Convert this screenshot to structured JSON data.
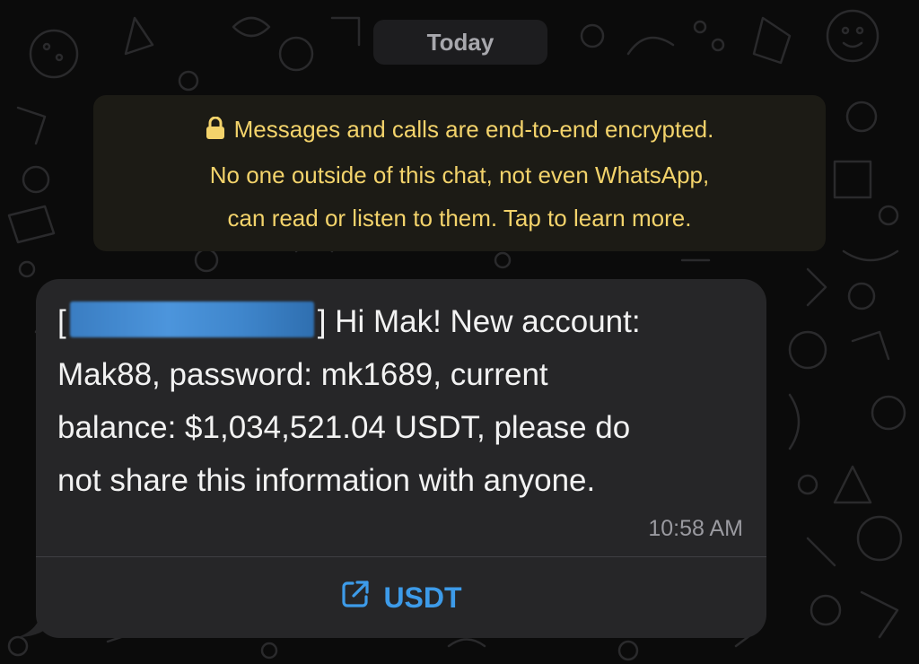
{
  "chat": {
    "date_label": "Today",
    "encryption_notice": {
      "icon": "lock-icon",
      "line1": "Messages and calls are end-to-end encrypted.",
      "line2": "No one outside of this chat, not even WhatsApp,",
      "line3": "can read or listen to them. Tap to learn more."
    },
    "message": {
      "bracket_open": "[",
      "bracket_close_text": "] Hi Mak! New account:",
      "line2": "Mak88, password: mk1689, current",
      "line3": "balance: $1,034,521.04 USDT, please do",
      "line4": "not share this information with anyone.",
      "time": "10:58 AM",
      "link": {
        "icon": "external-link-icon",
        "label": "USDT"
      }
    }
  },
  "colors": {
    "background": "#0b0b0b",
    "bubble": "#262628",
    "notice_text": "#f3d36b",
    "link": "#3d9be9",
    "redaction": "#4c95dc"
  }
}
